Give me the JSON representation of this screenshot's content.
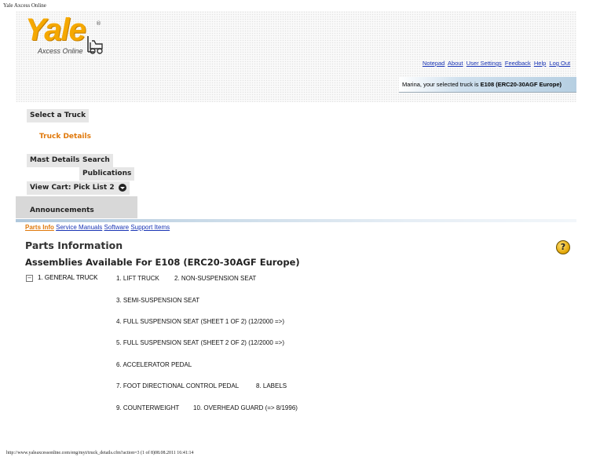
{
  "browser_title": "Yale Axcess Online",
  "logo": {
    "brand": "Yale",
    "reg_mark": "®",
    "subtitle": "Axcess Online"
  },
  "top_links": [
    "Notepad",
    "About",
    "User Settings",
    "Feedback",
    "Help",
    "Log Out"
  ],
  "selected_truck": {
    "prefix": "Marina, your selected truck is ",
    "model": "E108 (ERC20-30AGF Europe)"
  },
  "nav": {
    "select_truck": "Select a Truck",
    "truck_details": "Truck Details",
    "mast_details": "Mast Details",
    "search": "Search",
    "publications": "Publications",
    "view_cart": "View Cart: Pick List 2",
    "announcements": "Announcements"
  },
  "subnav": [
    "Parts Info",
    "Service Manuals",
    "Software",
    "Support Items"
  ],
  "page_title": "Parts Information",
  "section_title": "Assemblies Available For E108 (ERC20-30AGF Europe)",
  "tree": {
    "root": "1. GENERAL TRUCK",
    "assemblies": [
      "1. LIFT TRUCK",
      "2. NON-SUSPENSION SEAT",
      "3. SEMI-SUSPENSION SEAT",
      "4. FULL SUSPENSION SEAT (SHEET 1 OF 2) (12/2000 =>)",
      "5. FULL SUSPENSION SEAT (SHEET 2 OF 2) (12/2000 =>)",
      "6. ACCELERATOR PEDAL",
      "7. FOOT DIRECTIONAL CONTROL PEDAL",
      "8. LABELS",
      "9. COUNTERWEIGHT",
      "10. OVERHEAD GUARD (=> 8/1996)"
    ]
  },
  "help_glyph": "?",
  "footer": "http://www.yaleaxcessonline.com/eng/myt/truck_details.cfm?action=3 (1 of 8)08.08.2011 16:41:14",
  "colors": {
    "brand_yellow": "#f5a800",
    "link_blue": "#1a35b5",
    "active_orange": "#e0780a"
  }
}
